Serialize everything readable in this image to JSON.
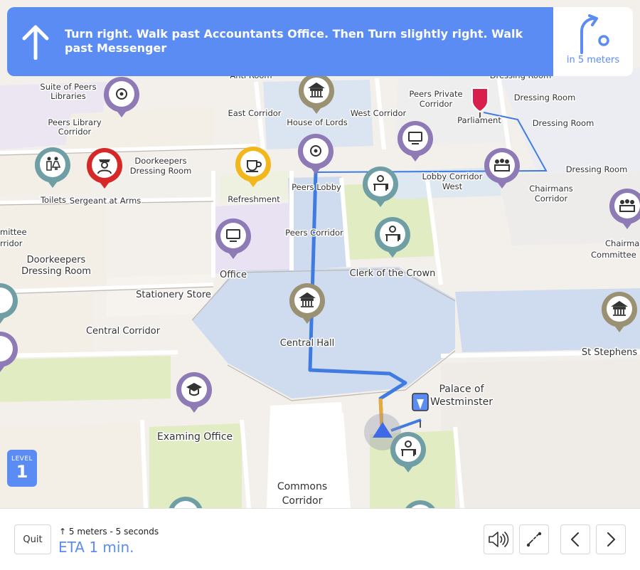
{
  "banner": {
    "instruction": "Turn right. Walk past Accountants Office. Then Turn slightly right. Walk past Messenger",
    "next_distance": "in 5 meters",
    "main_icon": "arrow-up-icon",
    "next_icon": "turn-right-icon"
  },
  "level": {
    "label": "LEVEL",
    "number": "1"
  },
  "map": {
    "rooms": {
      "suite_of_peers_libraries": [
        "Suite of Peers",
        "Libraries"
      ],
      "peers_library_corridor": [
        "Peers Library",
        "Corridor"
      ],
      "anti_room": "Anti Room",
      "east_corridor": "East Corridor",
      "house_of_lords": "House of Lords",
      "west_corridor": "West Corridor",
      "peers_private_corridor": [
        "Peers Private",
        "Corridor"
      ],
      "parliament": "Parliament",
      "dressing_room_1": "Dressing Room",
      "dressing_room_2": "Dressing Room",
      "dressing_room_3": "Dressing Room",
      "dressing_room_4": "Dressing Room",
      "doorkeepers_dressing_room_top": [
        "Doorkeepers",
        "Dressing Room"
      ],
      "toilets": "Toilets",
      "sergeant_at_arms": "Sergeant at Arms",
      "refreshment": "Refreshment",
      "peers_lobby": "Peers Lobby",
      "lobby_corridor_west": [
        "Lobby Corridor",
        "West"
      ],
      "chairmans_corridor": [
        "Chairmans",
        "Corridor"
      ],
      "committee_left": [
        "mittee",
        "rridor"
      ],
      "peers_corridor": "Peers Corridor",
      "chairmans_committee": [
        "Chairma",
        "Committee"
      ],
      "doorkeepers_dressing_room_left": [
        "Doorkeepers",
        "Dressing Room"
      ],
      "office": "Office",
      "clerk_of_the_crown": "Clerk of the Crown",
      "stationery_store": "Stationery Store",
      "central_corridor": "Central Corridor",
      "central_hall": "Central Hall",
      "st_stephens": "St Stephens",
      "palace_of_westminster": [
        "Palace of",
        "Westminster"
      ],
      "examing_office": "Examing Office",
      "commons_corridor": [
        "Commons",
        "Corridor"
      ]
    },
    "pois": [
      {
        "name": "settings-poi-icon",
        "color": "#8e7ab5"
      },
      {
        "name": "landmark-poi-icon",
        "color": "#9a9072"
      },
      {
        "name": "destination-flag-icon",
        "color": "#d8204a"
      },
      {
        "name": "restroom-poi-icon",
        "color": "#6f9fa5"
      },
      {
        "name": "guard-poi-icon",
        "color": "#d62828"
      },
      {
        "name": "cafe-poi-icon",
        "color": "#f2b71d"
      },
      {
        "name": "computer-poi-icon",
        "color": "#8e7ab5"
      },
      {
        "name": "meeting-poi-icon",
        "color": "#8e7ab5"
      },
      {
        "name": "desk-poi-icon",
        "color": "#6f9fa5"
      },
      {
        "name": "education-poi-icon",
        "color": "#8e7ab5"
      },
      {
        "name": "start-marker-icon",
        "color": "#5b8cf4"
      },
      {
        "name": "user-location-icon",
        "color": "#4069e8"
      }
    ],
    "route_color": "#3f7be0",
    "colors": {
      "floor": "#f3f0eb",
      "hall": "#cfdbef",
      "green_rooms": "#e2ecc3",
      "purple_rooms": "#e9e2f3",
      "walls": "#ffffff"
    }
  },
  "bottom": {
    "quit_label": "Quit",
    "step_distance": "5 meters",
    "separator": " - ",
    "step_time": "5 seconds",
    "eta": "ETA 1 min.",
    "sound_icon": "sound-icon",
    "route_icon": "route-overview-icon",
    "prev_icon": "chevron-left-icon",
    "next_icon": "chevron-right-icon"
  }
}
